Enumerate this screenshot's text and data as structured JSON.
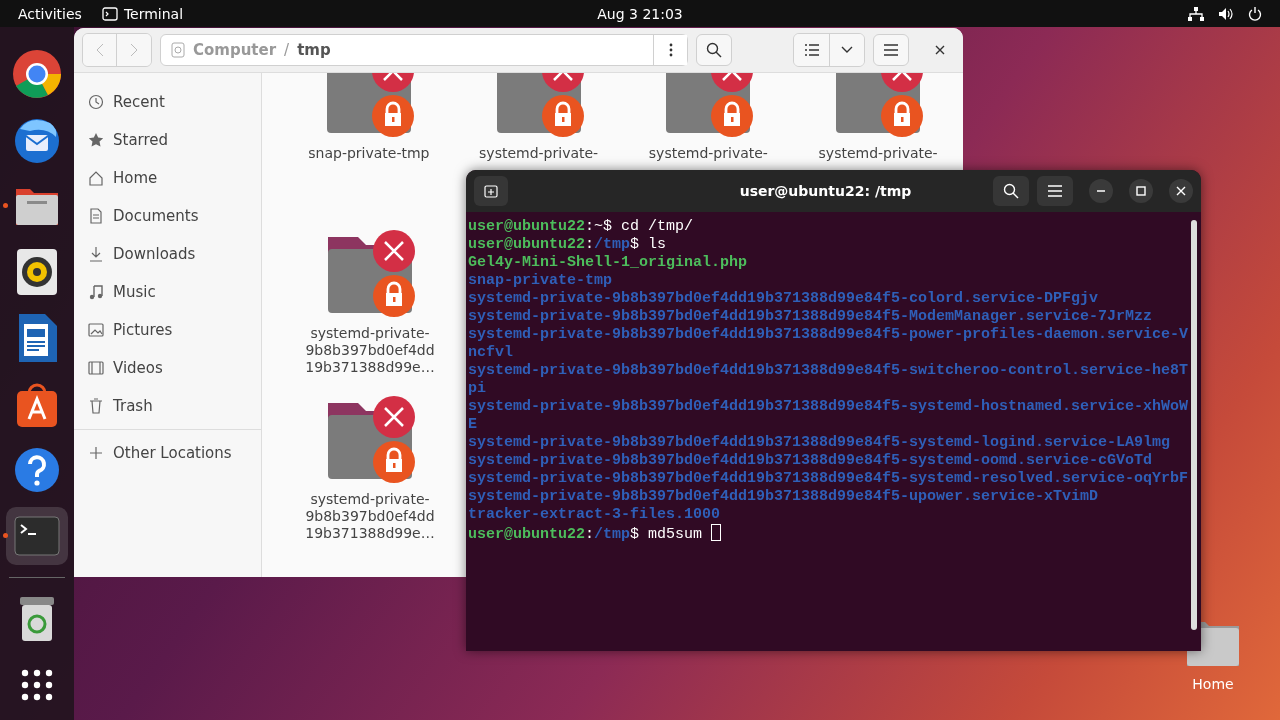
{
  "top_bar": {
    "activities": "Activities",
    "app_name": "Terminal",
    "clock": "Aug 3  21:03"
  },
  "dock": {
    "items": [
      {
        "kind": "browser",
        "running": false,
        "selected": false
      },
      {
        "kind": "mail",
        "running": false,
        "selected": false
      },
      {
        "kind": "files",
        "running": true,
        "selected": false
      },
      {
        "kind": "music",
        "running": false,
        "selected": false
      },
      {
        "kind": "writer",
        "running": false,
        "selected": false
      },
      {
        "kind": "store",
        "running": false,
        "selected": false
      },
      {
        "kind": "help",
        "running": false,
        "selected": false
      },
      {
        "kind": "terminal",
        "running": true,
        "selected": true
      },
      {
        "kind": "trash",
        "running": false,
        "selected": false
      },
      {
        "kind": "apps",
        "running": false,
        "selected": false
      }
    ]
  },
  "desktop_icons": [
    {
      "label": "Home"
    }
  ],
  "file_manager": {
    "path": [
      {
        "kind": "crumb",
        "text": "Computer"
      },
      {
        "kind": "separator",
        "text": "/"
      },
      {
        "kind": "current",
        "text": "tmp"
      }
    ],
    "sidebar": [
      {
        "kind": "recent",
        "label": "Recent"
      },
      {
        "kind": "starred",
        "label": "Starred"
      },
      {
        "kind": "home",
        "label": "Home"
      },
      {
        "kind": "documents",
        "label": "Documents"
      },
      {
        "kind": "downloads",
        "label": "Downloads"
      },
      {
        "kind": "music",
        "label": "Music"
      },
      {
        "kind": "pictures",
        "label": "Pictures"
      },
      {
        "kind": "videos",
        "label": "Videos"
      },
      {
        "kind": "trash",
        "label": "Trash"
      },
      {
        "kind": "other",
        "label": "Other Locations"
      }
    ],
    "grid": [
      [
        {
          "label": [
            "snap-private-tmp"
          ]
        },
        {
          "label": [
            "systemd-private-"
          ]
        },
        {
          "label": [
            "systemd-private-"
          ]
        },
        {
          "label": [
            "systemd-private-"
          ]
        }
      ],
      [
        {
          "label": [
            "systemd-private-",
            "9b8b397bd0ef4dd",
            "19b371388d99e…"
          ]
        }
      ],
      [
        {
          "label": [
            "systemd-private-",
            "9b8b397bd0ef4dd",
            "19b371388d99e…"
          ]
        }
      ]
    ]
  },
  "terminal": {
    "title": "user@ubuntu22: /tmp",
    "cursor_visible": true,
    "lines": [
      [
        {
          "kind": "user",
          "text": "user@ubuntu22"
        },
        {
          "kind": "plain",
          "text": ":~$ cd /tmp/"
        }
      ],
      [
        {
          "kind": "user",
          "text": "user@ubuntu22"
        },
        {
          "kind": "plain",
          "text": ":"
        },
        {
          "kind": "path",
          "text": "/tmp"
        },
        {
          "kind": "plain",
          "text": "$ ls"
        }
      ],
      [
        {
          "kind": "exec",
          "text": "Gel4y-Mini-Shell-1_original.php"
        }
      ],
      [
        {
          "kind": "dir",
          "text": "snap-private-tmp"
        }
      ],
      [
        {
          "kind": "dir",
          "text": "systemd-private-9b8b397bd0ef4dd19b371388d99e84f5-colord.service-DPFgjv"
        }
      ],
      [
        {
          "kind": "dir",
          "text": "systemd-private-9b8b397bd0ef4dd19b371388d99e84f5-ModemManager.service-7JrMzz"
        }
      ],
      [
        {
          "kind": "dir",
          "text": "systemd-private-9b8b397bd0ef4dd19b371388d99e84f5-power-profiles-daemon.service-V"
        }
      ],
      [
        {
          "kind": "dir",
          "text": "ncfvl"
        }
      ],
      [
        {
          "kind": "dir",
          "text": "systemd-private-9b8b397bd0ef4dd19b371388d99e84f5-switcheroo-control.service-he8T"
        }
      ],
      [
        {
          "kind": "dir",
          "text": "pi"
        }
      ],
      [
        {
          "kind": "dir",
          "text": "systemd-private-9b8b397bd0ef4dd19b371388d99e84f5-systemd-hostnamed.service-xhWoW"
        }
      ],
      [
        {
          "kind": "dir",
          "text": "E"
        }
      ],
      [
        {
          "kind": "dir",
          "text": "systemd-private-9b8b397bd0ef4dd19b371388d99e84f5-systemd-logind.service-LA9lmg"
        }
      ],
      [
        {
          "kind": "dir",
          "text": "systemd-private-9b8b397bd0ef4dd19b371388d99e84f5-systemd-oomd.service-cGVoTd"
        }
      ],
      [
        {
          "kind": "dir",
          "text": "systemd-private-9b8b397bd0ef4dd19b371388d99e84f5-systemd-resolved.service-oqYrbF"
        }
      ],
      [
        {
          "kind": "dir",
          "text": "systemd-private-9b8b397bd0ef4dd19b371388d99e84f5-upower.service-xTvimD"
        }
      ],
      [
        {
          "kind": "dir",
          "text": "tracker-extract-3-files.1000"
        }
      ],
      [
        {
          "kind": "user",
          "text": "user@ubuntu22"
        },
        {
          "kind": "plain",
          "text": ":"
        },
        {
          "kind": "path",
          "text": "/tmp"
        },
        {
          "kind": "plain",
          "text": "$ md5sum "
        }
      ]
    ]
  }
}
